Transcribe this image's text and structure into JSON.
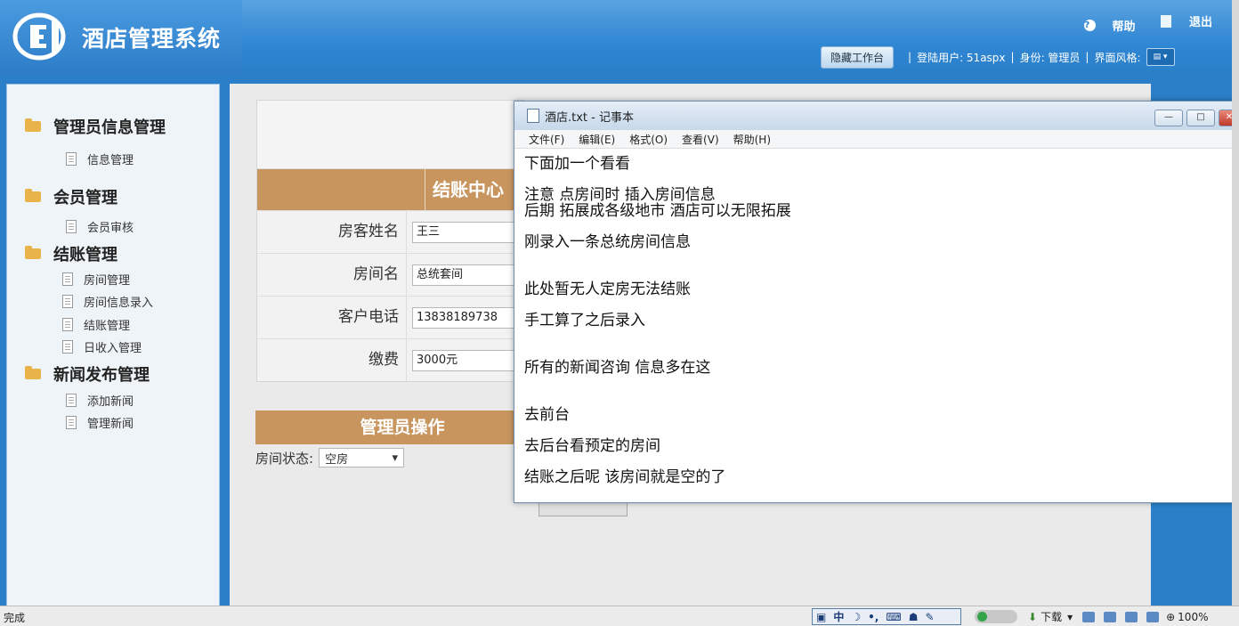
{
  "app": {
    "title": "酒店管理系统",
    "help": "帮助",
    "logout": "退出",
    "hide_workbench": "隐藏工作台",
    "login_user": "登陆用户: 51aspx",
    "role": "身份: 管理员",
    "skin": "界面风格:"
  },
  "sidebar": {
    "groups": [
      {
        "label": "管理员信息管理",
        "items": [
          "信息管理"
        ]
      },
      {
        "label": "会员管理",
        "items": [
          "会员审核"
        ]
      },
      {
        "label": "结账管理",
        "items": [
          "房间管理",
          "房间信息录入",
          "结账管理",
          "日收入管理"
        ]
      },
      {
        "label": "新闻发布管理",
        "items": [
          "添加新闻",
          "管理新闻"
        ]
      }
    ]
  },
  "checkout": {
    "header": "结账中心",
    "fields": [
      {
        "label": "房客姓名",
        "value": "王三"
      },
      {
        "label": "房间名",
        "value": "总统套间"
      },
      {
        "label": "客户电话",
        "value": "13838189738"
      },
      {
        "label": "缴费",
        "value": "3000元"
      }
    ],
    "admin_header": "管理员操作",
    "room_status_label": "房间状态:",
    "room_status_value": "空房"
  },
  "notepad": {
    "title": "酒店.txt - 记事本",
    "menu": [
      "文件(F)",
      "编辑(E)",
      "格式(O)",
      "查看(V)",
      "帮助(H)"
    ],
    "lines": [
      "下面加一个看看",
      "注意 点房间时 插入房间信息",
      "后期 拓展成各级地市 酒店可以无限拓展",
      "刚录入一条总统房间信息",
      "此处暂无人定房无法结账",
      "手工算了之后录入",
      "所有的新闻咨询 信息多在这",
      "去前台",
      "去后台看预定的房间",
      "结账之后呢 该房间就是空的了"
    ]
  },
  "statusbar": {
    "left": "完成",
    "ime": "中",
    "download": "下载",
    "zoom": "100%"
  }
}
